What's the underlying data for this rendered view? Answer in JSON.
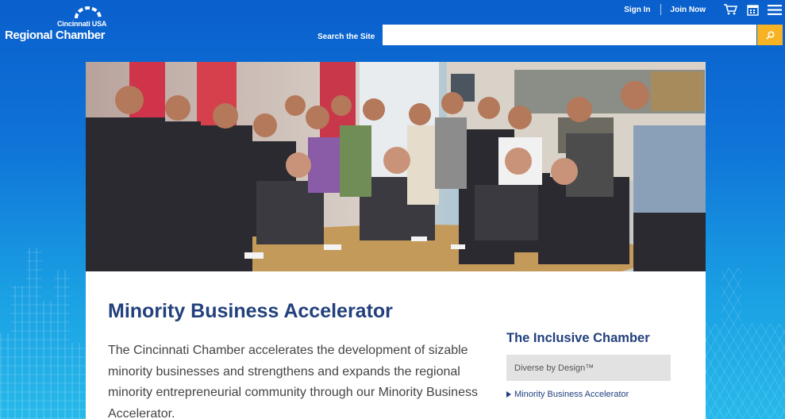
{
  "header": {
    "logo": {
      "line1": "Cincinnati USA",
      "line2": "Regional Chamber"
    },
    "nav": {
      "sign_in": "Sign In",
      "join_now": "Join Now"
    },
    "icons": [
      "cart-icon",
      "calendar-icon",
      "menu-icon"
    ],
    "search": {
      "label": "Search the Site",
      "value": "",
      "placeholder": ""
    }
  },
  "main": {
    "title": "Minority Business Accelerator",
    "lead": "The Cincinnati Chamber accelerates the development of sizable minority businesses and strengthens and expands the regional minority entrepreneurial community through our Minority Business Accelerator."
  },
  "sidebar": {
    "title": "The Inclusive Chamber",
    "items": [
      {
        "label": "Diverse by Design™",
        "active": false
      },
      {
        "label": "Minority Business Accelerator",
        "active": true
      }
    ]
  },
  "colors": {
    "brand_blue": "#22407d",
    "accent_yellow": "#f7b324",
    "header_bg": "#0a5fcc"
  }
}
